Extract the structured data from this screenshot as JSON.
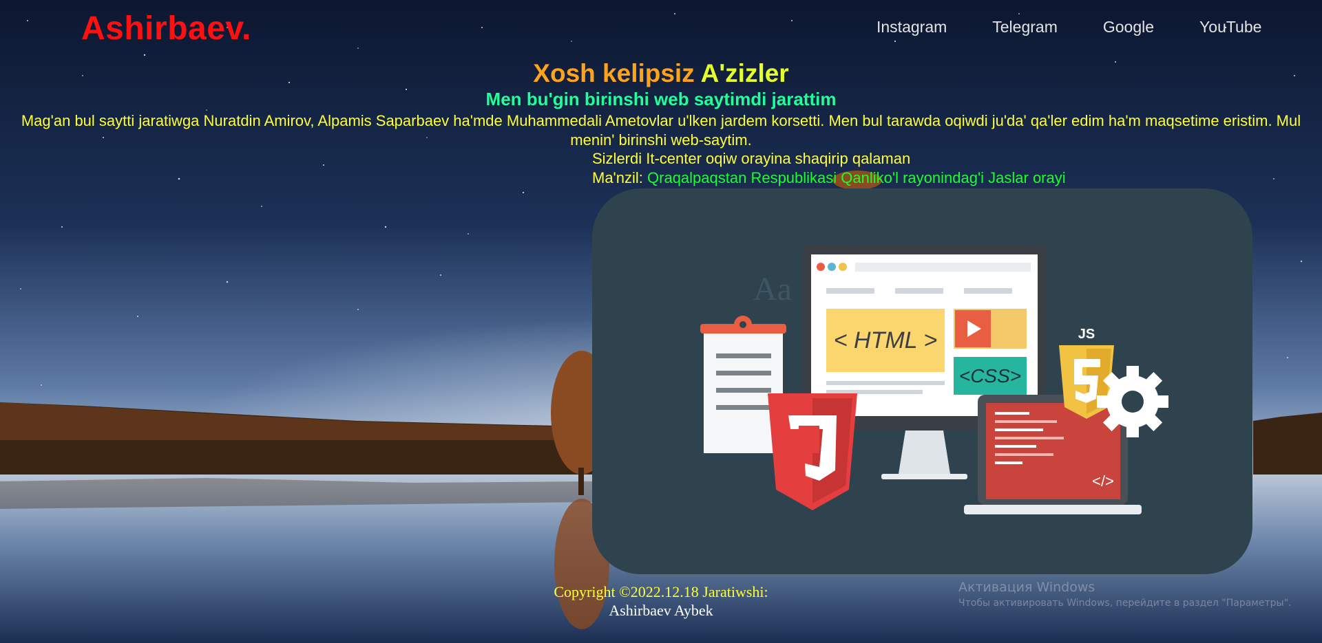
{
  "header": {
    "logo": "Ashirbaev.",
    "nav": [
      "Instagram",
      "Telegram",
      "Google",
      "YouTube"
    ]
  },
  "hero": {
    "welcome_part1": "Xosh kelipsiz",
    "welcome_part2": "A'zizler",
    "subtitle": "Men bu'gin birinshi web saytimdi jarattim",
    "paragraph": "Mag'an bul saytti jaratiwga Nuratdin Amirov, Alpamis Saparbaev ha'mde Muhammedali Ametovlar u'lken jardem korsetti. Men bul tarawda oqiwdi ju'da' qa'ler edim ha'm maqsetime eristim. Mul menin' birinshi web-saytim.",
    "invite": "Sizlerdi It-center oqiw orayina shaqirip qalaman",
    "address_label": "Ma'nzil:",
    "address_value": "Qraqalpaqstan Respublikasi Qanliko'l rayonindag'i Jaslar orayi"
  },
  "illustration": {
    "html_label": "< HTML >",
    "css_label": "<CSS>",
    "js_label": "JS",
    "code_tag": "</>",
    "font_glyph": "Aa"
  },
  "footer": {
    "line1": "Copyright ©2022.12.18 Jaratiwshi:",
    "line2": "Ashirbaev Aybek"
  },
  "windows_watermark": {
    "title": "Активация Windows",
    "subtitle": "Чтобы активировать Windows, перейдите в раздел \"Параметры\"."
  },
  "colors": {
    "logo": "#ff1010",
    "welcome_orange": "#ffa31a",
    "welcome_yellow": "#e6ff2b",
    "subtitle_green": "#1fff9a",
    "text_yellow": "#ffff3a",
    "address_green": "#1aff2a",
    "card_bg": "#2f434f"
  }
}
